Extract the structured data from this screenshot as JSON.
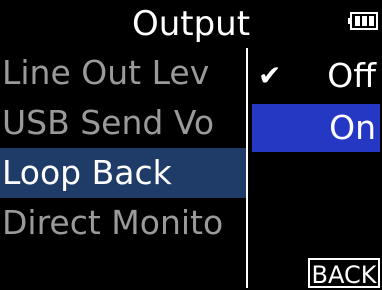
{
  "header": {
    "title": "Output"
  },
  "menu": {
    "items": [
      {
        "label": "Line Out Lev"
      },
      {
        "label": "USB Send Vo"
      },
      {
        "label": "Loop Back"
      },
      {
        "label": "Direct Monito"
      }
    ],
    "selected_index": 2
  },
  "submenu": {
    "options": [
      {
        "label": "Off",
        "check": "✔"
      },
      {
        "label": "On"
      }
    ],
    "checked_index": 0,
    "highlight_index": 1
  },
  "footer": {
    "back_label": "BACK"
  },
  "colors": {
    "selected_item": "#1f3c68",
    "highlight_option": "#2438c4"
  }
}
